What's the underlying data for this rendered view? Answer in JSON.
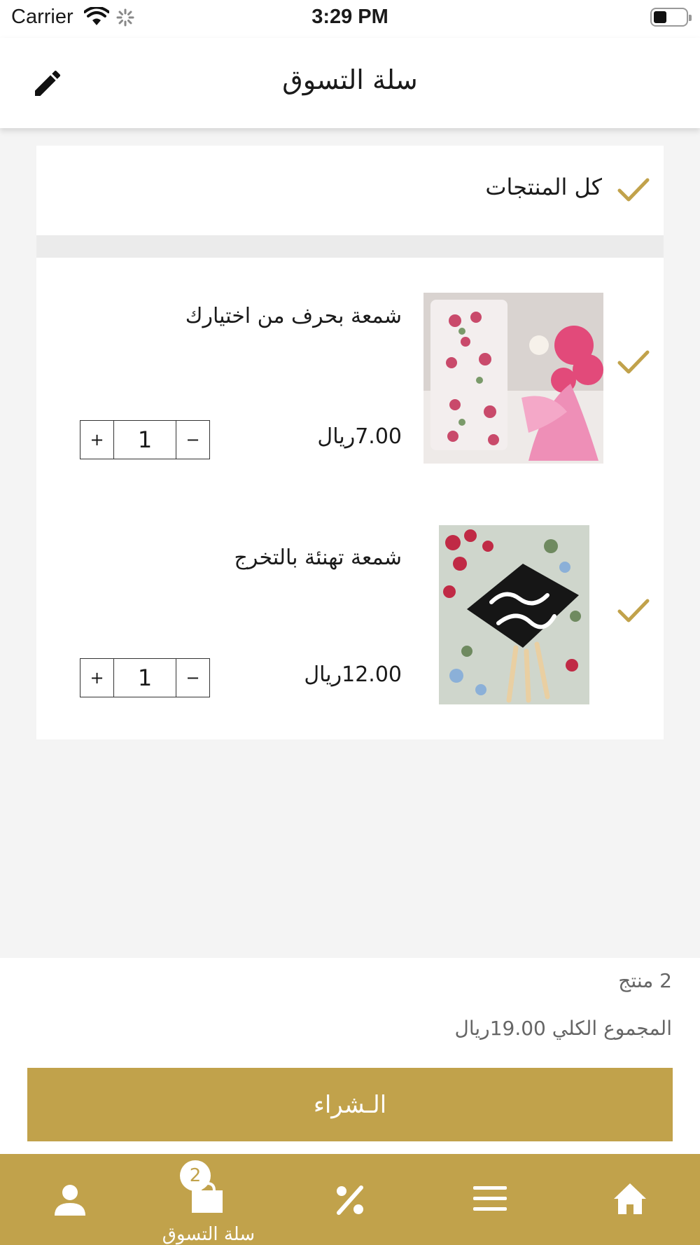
{
  "status_bar": {
    "carrier": "Carrier",
    "time": "3:29 PM"
  },
  "header": {
    "title": "سلة التسوق",
    "edit_icon": "pencil-icon"
  },
  "cart": {
    "select_all_label": "كل المنتجات",
    "items": [
      {
        "name": "شمعة بحرف من اختيارك",
        "price": "7.00ريال",
        "quantity": "1",
        "image": "flower-letter-candle-photo"
      },
      {
        "name": "شمعة تهنئة بالتخرج",
        "price": "12.00ريال",
        "quantity": "1",
        "image": "graduation-candle-photo"
      }
    ],
    "stepper": {
      "plus": "+",
      "minus": "−"
    }
  },
  "summary": {
    "item_count": "2 منتج",
    "total_label": "المجموع الكلي",
    "total_value": "19.00ريال",
    "buy_label": "الـشراء"
  },
  "tabbar": {
    "cart_label": "سلة التسوق",
    "cart_badge": "2",
    "icons": [
      "user-icon",
      "cart-icon",
      "percent-icon",
      "menu-icon",
      "home-icon"
    ]
  },
  "colors": {
    "accent": "#c1a24b",
    "background": "#f4f4f4"
  }
}
